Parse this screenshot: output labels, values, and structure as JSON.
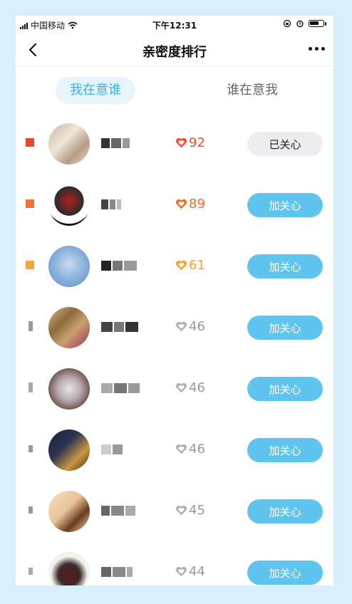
{
  "status_bar": {
    "carrier": "中国移动",
    "time": "下午12:31"
  },
  "nav": {
    "title": "亲密度排行"
  },
  "tabs": [
    {
      "label": "我在意谁",
      "active": true
    },
    {
      "label": "谁在意我",
      "active": false
    }
  ],
  "colors": {
    "accent": "#39b2dc",
    "tab_active_bg": "#e6f5fb",
    "follow_button": "#5fc4ee",
    "followed_button": "#ececf1",
    "heart_top1": "#f0502f",
    "heart_top2": "#f26b2a",
    "heart_top3": "#f5a02c",
    "heart_gray": "#b0b0b0"
  },
  "ranking": [
    {
      "score": "92",
      "button": "已关心",
      "followed": true,
      "heart": "heart-filled-icon",
      "score_color": "#f0502f",
      "rank_color": "#e8492e"
    },
    {
      "score": "89",
      "button": "加关心",
      "followed": false,
      "heart": "heart-filled-icon",
      "score_color": "#f26b2a",
      "rank_color": "#f07036"
    },
    {
      "score": "61",
      "button": "加关心",
      "followed": false,
      "heart": "heart-filled-icon",
      "score_color": "#f5a02c",
      "rank_color": "#f4a640"
    },
    {
      "score": "46",
      "button": "加关心",
      "followed": false,
      "heart": "heart-outline-icon",
      "score_color": "#999999",
      "rank_color": "#999999"
    },
    {
      "score": "46",
      "button": "加关心",
      "followed": false,
      "heart": "heart-outline-icon",
      "score_color": "#999999",
      "rank_color": "#aaaaaa"
    },
    {
      "score": "46",
      "button": "加关心",
      "followed": false,
      "heart": "heart-outline-icon",
      "score_color": "#999999",
      "rank_color": "#999999"
    },
    {
      "score": "45",
      "button": "加关心",
      "followed": false,
      "heart": "heart-outline-icon",
      "score_color": "#999999",
      "rank_color": "#999999"
    },
    {
      "score": "44",
      "button": "加关心",
      "followed": false,
      "heart": "heart-outline-icon",
      "score_color": "#999999",
      "rank_color": "#aaaaaa"
    }
  ]
}
